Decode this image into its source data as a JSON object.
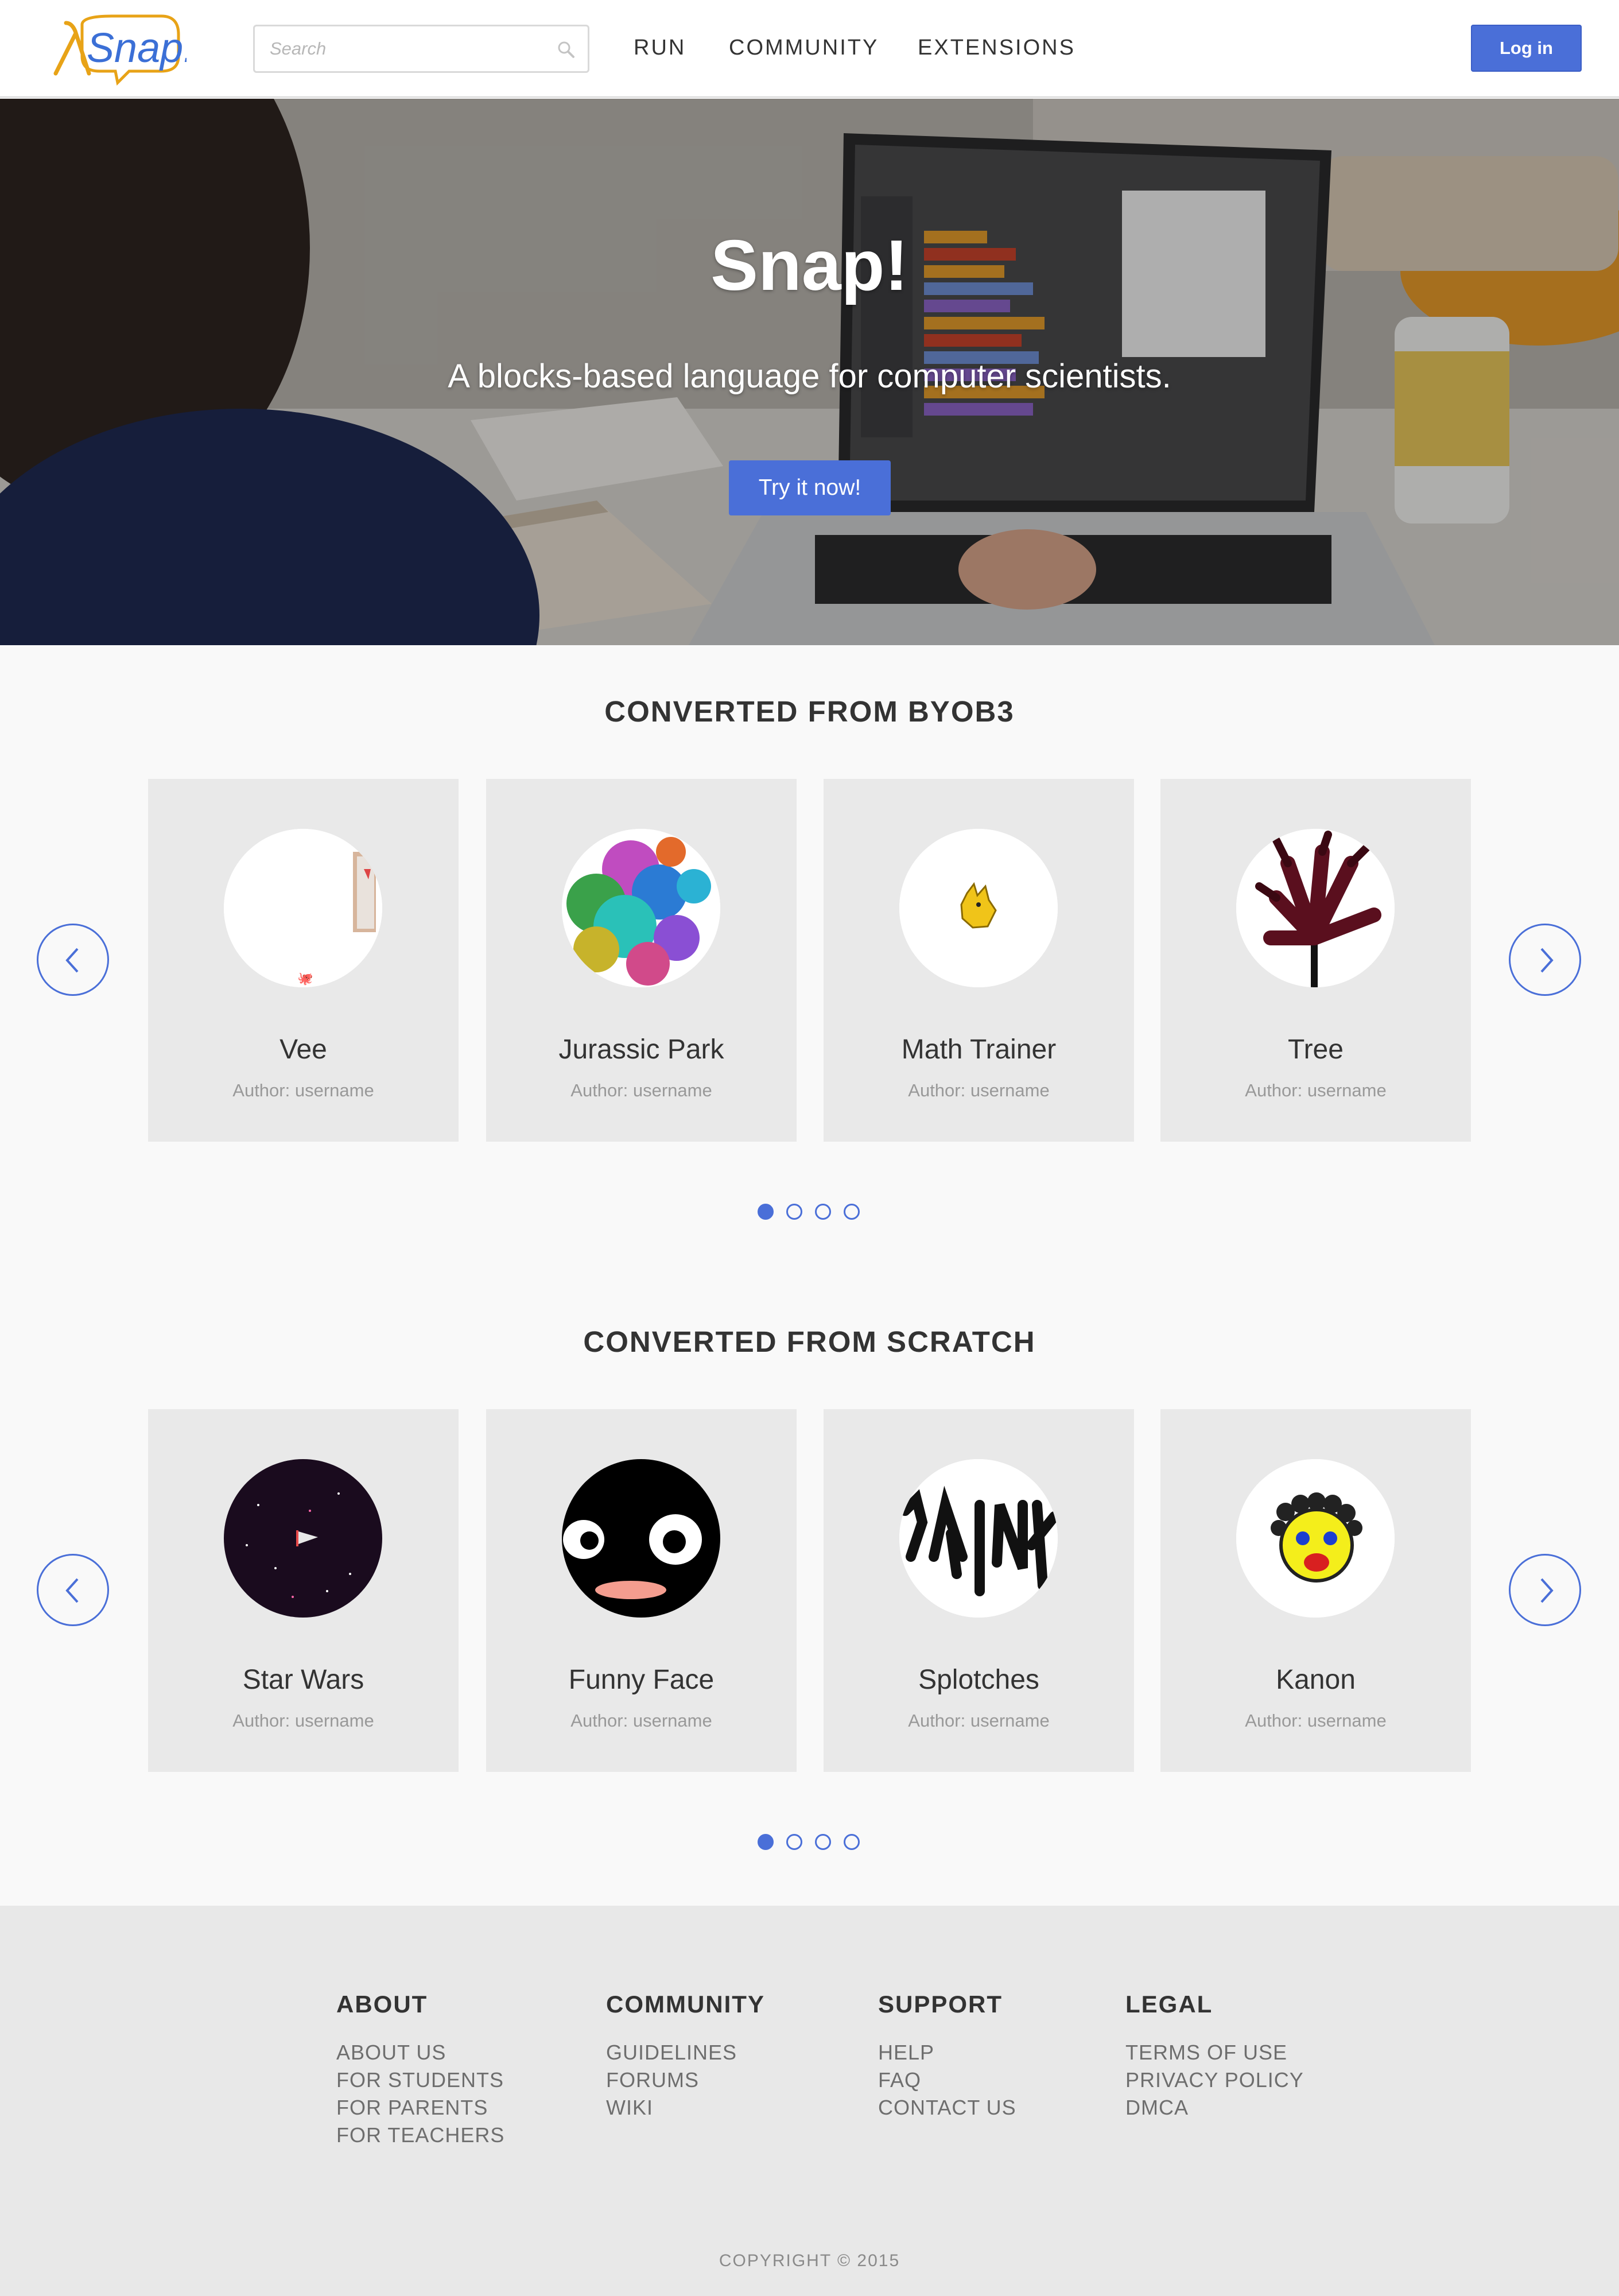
{
  "header": {
    "logo_text": "Snap!",
    "search_placeholder": "Search",
    "nav": [
      {
        "label": "RUN"
      },
      {
        "label": "COMMUNITY"
      },
      {
        "label": "EXTENSIONS"
      }
    ],
    "login_label": "Log in"
  },
  "hero": {
    "title": "Snap!",
    "subtitle": "A blocks-based language for computer scientists.",
    "cta_label": "Try it now!"
  },
  "sections": [
    {
      "title": "CONVERTED FROM BYOB3",
      "cards": [
        {
          "title": "Vee",
          "author": "Author: username"
        },
        {
          "title": "Jurassic Park",
          "author": "Author: username"
        },
        {
          "title": "Math Trainer",
          "author": "Author: username"
        },
        {
          "title": "Tree",
          "author": "Author: username"
        }
      ],
      "dots": 4,
      "active_dot": 0
    },
    {
      "title": "CONVERTED FROM SCRATCH",
      "cards": [
        {
          "title": "Star Wars",
          "author": "Author: username"
        },
        {
          "title": "Funny Face",
          "author": "Author: username"
        },
        {
          "title": "Splotches",
          "author": "Author: username"
        },
        {
          "title": "Kanon",
          "author": "Author: username"
        }
      ],
      "dots": 4,
      "active_dot": 0
    }
  ],
  "footer": {
    "columns": [
      {
        "heading": "ABOUT",
        "links": [
          "ABOUT US",
          "FOR STUDENTS",
          "FOR PARENTS",
          "FOR TEACHERS"
        ]
      },
      {
        "heading": "COMMUNITY",
        "links": [
          "GUIDELINES",
          "FORUMS",
          "WIKI"
        ]
      },
      {
        "heading": "SUPPORT",
        "links": [
          "HELP",
          "FAQ",
          "CONTACT US"
        ]
      },
      {
        "heading": "LEGAL",
        "links": [
          "TERMS OF USE",
          "PRIVACY POLICY",
          "DMCA"
        ]
      }
    ],
    "copyright": "COPYRIGHT © 2015"
  },
  "colors": {
    "accent": "#4a6fd8",
    "logo_blue": "#3b6fd6",
    "logo_orange": "#e8a317",
    "card_bg": "#e9e9e9",
    "footer_bg": "#e8e8e8"
  }
}
